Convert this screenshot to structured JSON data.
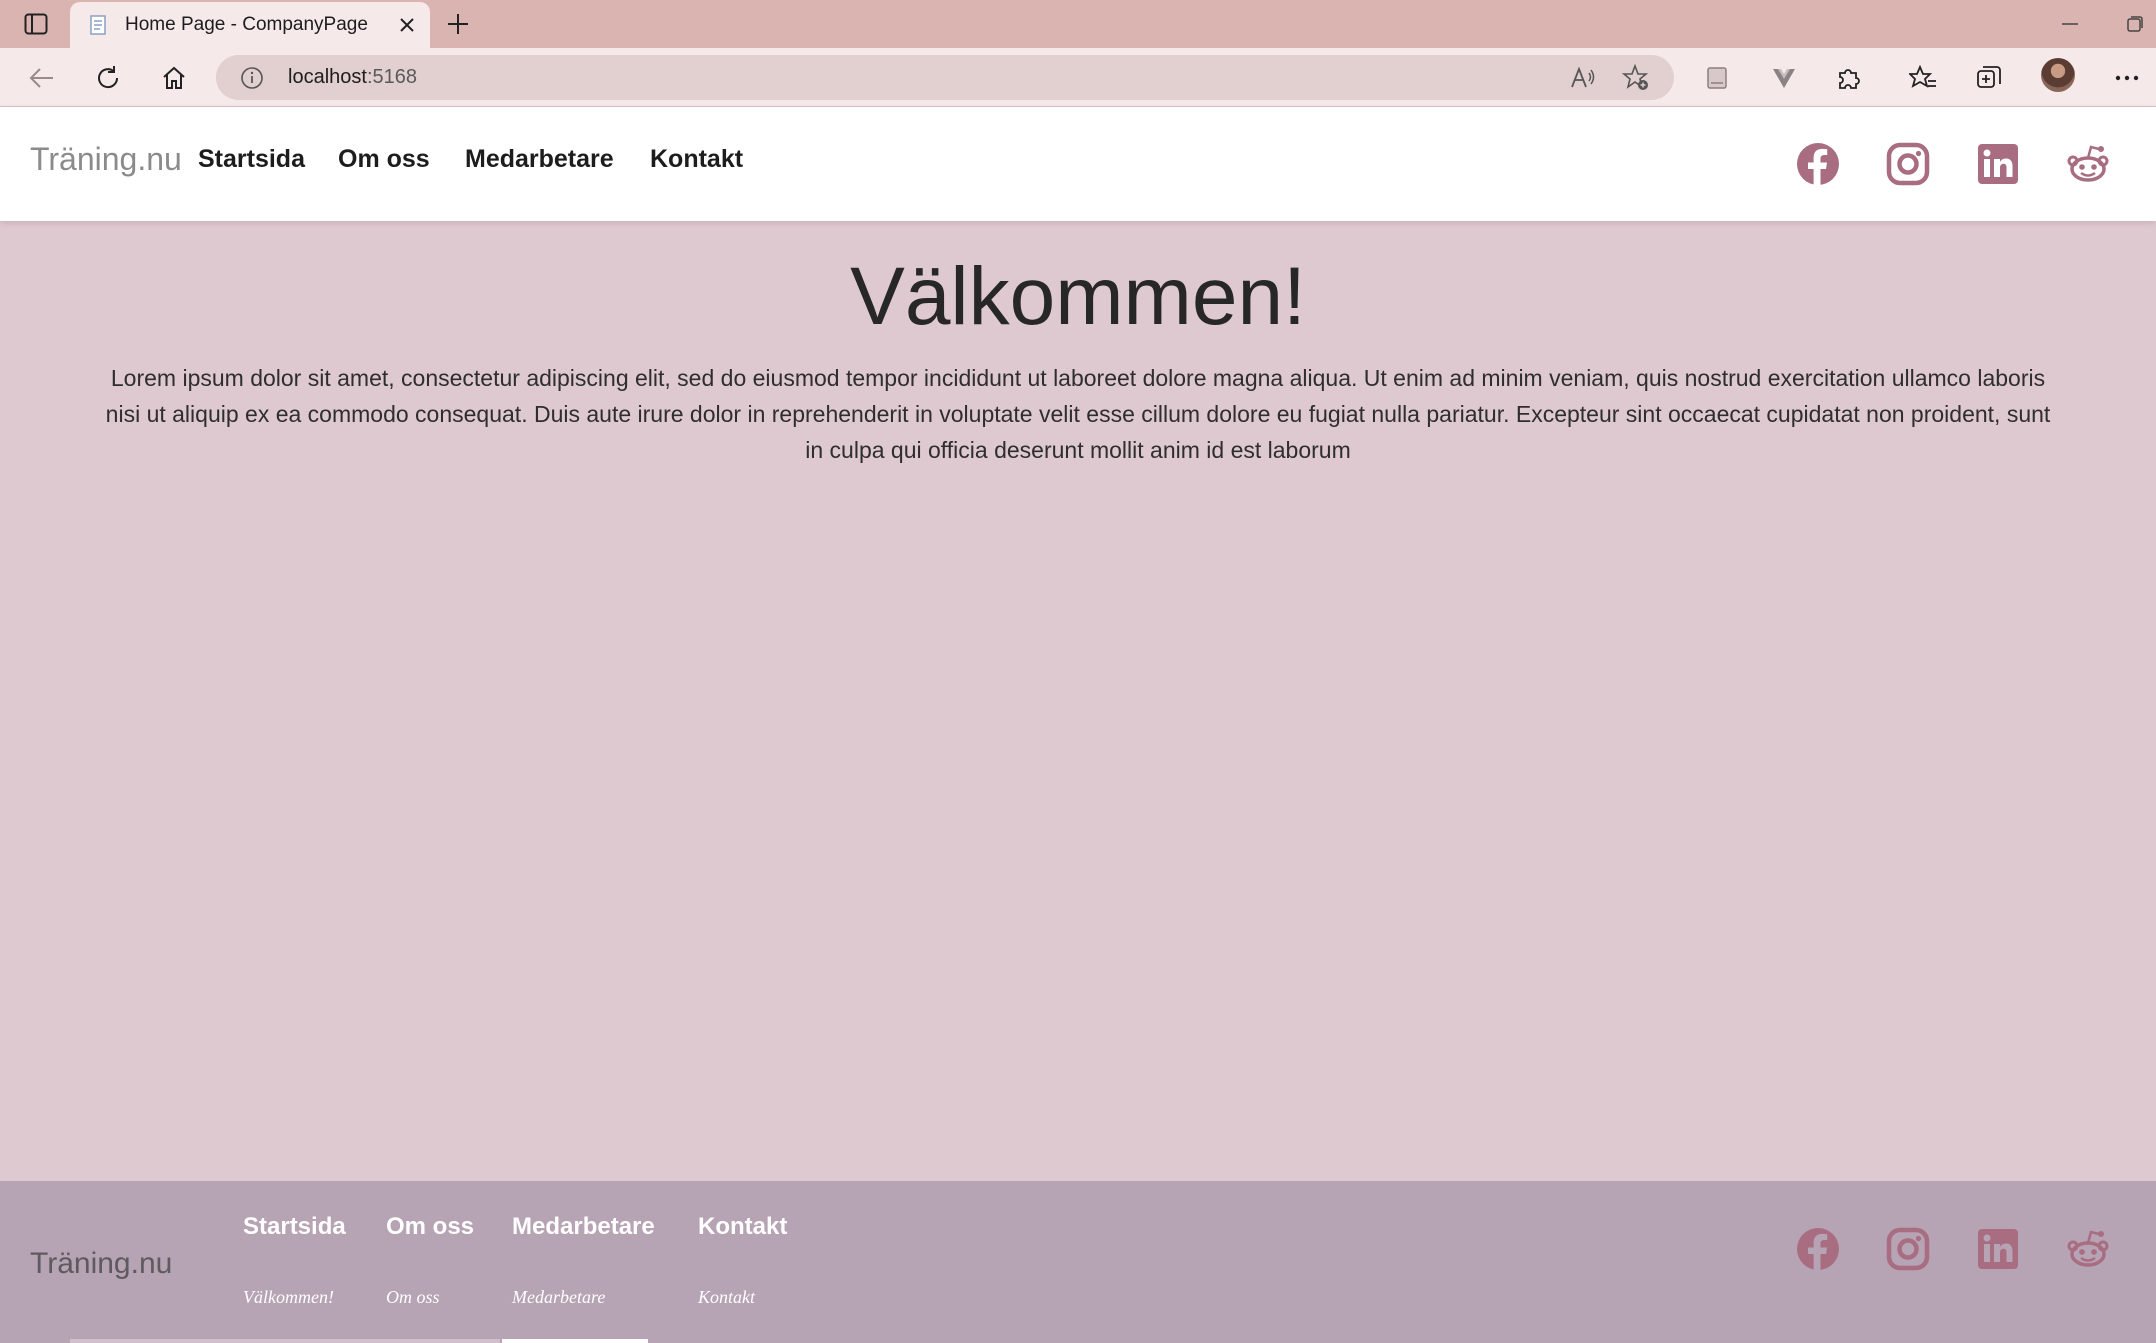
{
  "browser": {
    "tab_title": "Home Page - CompanyPage",
    "address_host": "localhost",
    "address_port": ":5168"
  },
  "site": {
    "brand": "Träning.nu",
    "nav": [
      {
        "label": "Startsida"
      },
      {
        "label": "Om oss"
      },
      {
        "label": "Medarbetare"
      },
      {
        "label": "Kontakt"
      }
    ],
    "social_icons": [
      "facebook-icon",
      "instagram-icon",
      "linkedin-icon",
      "reddit-icon"
    ],
    "accent_color": "#a86d80"
  },
  "main": {
    "title": "Välkommen!",
    "body": "Lorem ipsum dolor sit amet, consectetur adipiscing elit, sed do eiusmod tempor incididunt ut laboreet dolore magna aliqua. Ut enim ad minim veniam, quis nostrud exercitation ullamco laboris nisi ut aliquip ex ea commodo consequat. Duis aute irure dolor in reprehenderit in voluptate velit esse cillum dolore eu fugiat nulla pariatur. Excepteur sint occaecat cupidatat non proident, sunt in culpa qui officia deserunt mollit anim id est laborum"
  },
  "footer": {
    "brand": "Träning.nu",
    "columns": [
      {
        "heading": "Startsida",
        "sub": "Välkommen!"
      },
      {
        "heading": "Om oss",
        "sub": "Om oss"
      },
      {
        "heading": "Medarbetare",
        "sub": "Medarbetare"
      },
      {
        "heading": "Kontakt",
        "sub": "Kontakt"
      }
    ]
  }
}
